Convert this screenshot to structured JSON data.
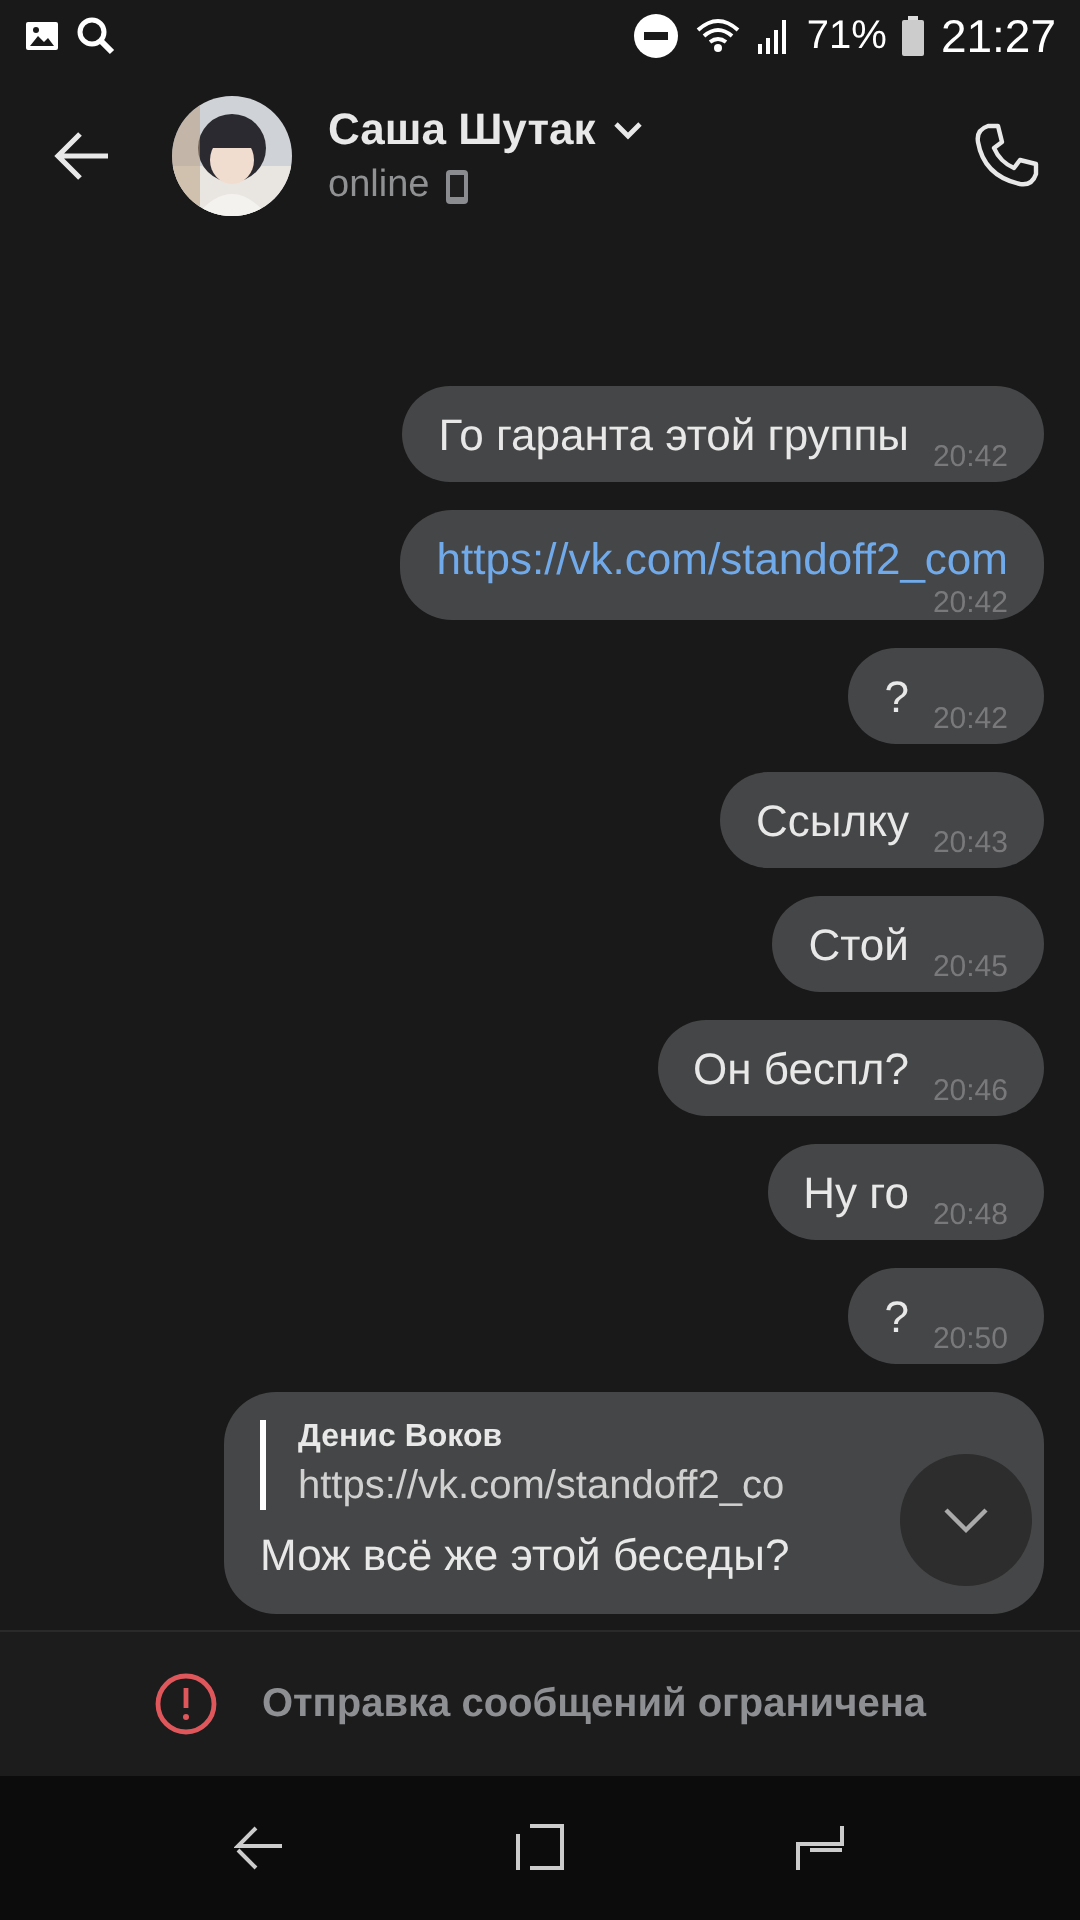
{
  "status_bar": {
    "battery": "71%",
    "time": "21:27"
  },
  "header": {
    "name": "Саша Шутак",
    "status": "online"
  },
  "messages": [
    {
      "kind": "text",
      "text": "Го гаранта этой группы",
      "time": "20:42"
    },
    {
      "kind": "link",
      "text": "https://vk.com/standoff2_com",
      "time": "20:42"
    },
    {
      "kind": "text",
      "text": "?",
      "time": "20:42"
    },
    {
      "kind": "text",
      "text": "Ссылку",
      "time": "20:43"
    },
    {
      "kind": "text",
      "text": "Стой",
      "time": "20:45"
    },
    {
      "kind": "text",
      "text": "Он беспл?",
      "time": "20:46"
    },
    {
      "kind": "text",
      "text": "Ну го",
      "time": "20:48"
    },
    {
      "kind": "text",
      "text": "?",
      "time": "20:50"
    },
    {
      "kind": "reply",
      "reply_author": "Денис Воков",
      "reply_text": "https://vk.com/standoff2_co",
      "text": "Мож всё же этой беседы?"
    }
  ],
  "notice": "Отправка сообщений ограничена"
}
